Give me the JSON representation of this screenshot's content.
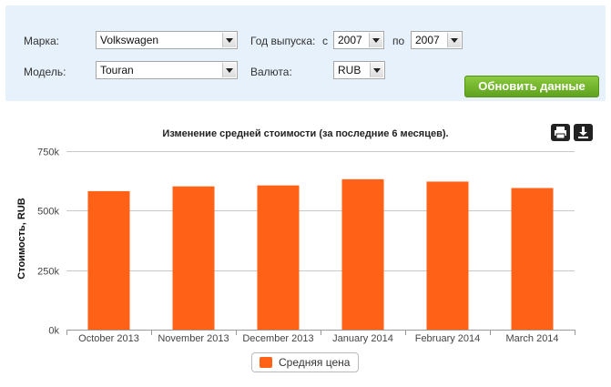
{
  "filters": {
    "make_label": "Марка:",
    "make_value": "Volkswagen",
    "model_label": "Модель:",
    "model_value": "Touran",
    "year_label": "Год выпуска:",
    "year_from_label": "с",
    "year_from_value": "2007",
    "year_to_label": "по",
    "year_to_value": "2007",
    "currency_label": "Валюта:",
    "currency_value": "RUB",
    "refresh_button": "Обновить данные"
  },
  "colors": {
    "bar": "#ff6116",
    "accent_button": "#6eb52b",
    "panel": "#e7f1fb"
  },
  "icons": {
    "print": "print-icon",
    "download": "download-icon"
  },
  "chart_data": {
    "type": "bar",
    "title": "Изменение средней стоимости (за последние 6 месяцев).",
    "ylabel": "Стоимость, RUB",
    "xlabel": "",
    "categories": [
      "October 2013",
      "November 2013",
      "December 2013",
      "January 2014",
      "February 2014",
      "March 2014"
    ],
    "series": [
      {
        "name": "Средняя цена",
        "values": [
          582000,
          602000,
          606000,
          632000,
          622000,
          595000
        ]
      }
    ],
    "ylim": [
      0,
      750000
    ],
    "yticks": [
      0,
      250000,
      500000,
      750000
    ],
    "ytick_labels": [
      "0k",
      "250k",
      "500k",
      "750k"
    ],
    "grid": true,
    "legend_position": "bottom-center"
  }
}
